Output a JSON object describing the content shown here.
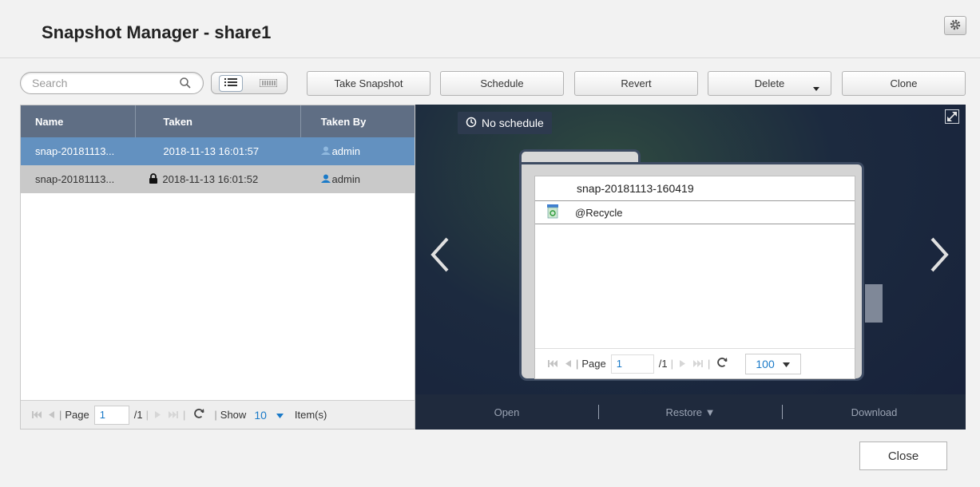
{
  "window": {
    "title": "Snapshot Manager - share1"
  },
  "search": {
    "placeholder": "Search"
  },
  "toolbar": {
    "take_snapshot": "Take Snapshot",
    "schedule": "Schedule",
    "revert": "Revert",
    "delete": "Delete",
    "clone": "Clone"
  },
  "table": {
    "columns": [
      "Name",
      "Taken",
      "Taken By"
    ],
    "rows": [
      {
        "name": "snap-20181113...",
        "taken": "2018-11-13 16:01:57",
        "taken_by": "admin",
        "locked": false,
        "selected": true
      },
      {
        "name": "snap-20181113...",
        "taken": "2018-11-13 16:01:52",
        "taken_by": "admin",
        "locked": true,
        "selected": false
      }
    ]
  },
  "left_pager": {
    "page_label": "Page",
    "page_value": "1",
    "total": "/1",
    "show_label": "Show",
    "show_value": "10",
    "items_label": "Item(s)"
  },
  "preview": {
    "schedule_status": "No schedule",
    "snapshot_name": "snap-20181113-160419",
    "items": [
      {
        "name": "@Recycle",
        "icon": "recycle-bin-icon"
      }
    ],
    "pager": {
      "page_label": "Page",
      "page_value": "1",
      "total": "/1",
      "per_page": "100"
    },
    "actions": {
      "open": "Open",
      "restore": "Restore ▼",
      "download": "Download"
    }
  },
  "footer": {
    "close": "Close"
  },
  "colors": {
    "table_header": "#5f6e84",
    "row_selected": "#6391c0",
    "row_alt": "#c9c9c9",
    "preview_bg": "#1c2a3f",
    "link_blue": "#1a7ac8"
  }
}
